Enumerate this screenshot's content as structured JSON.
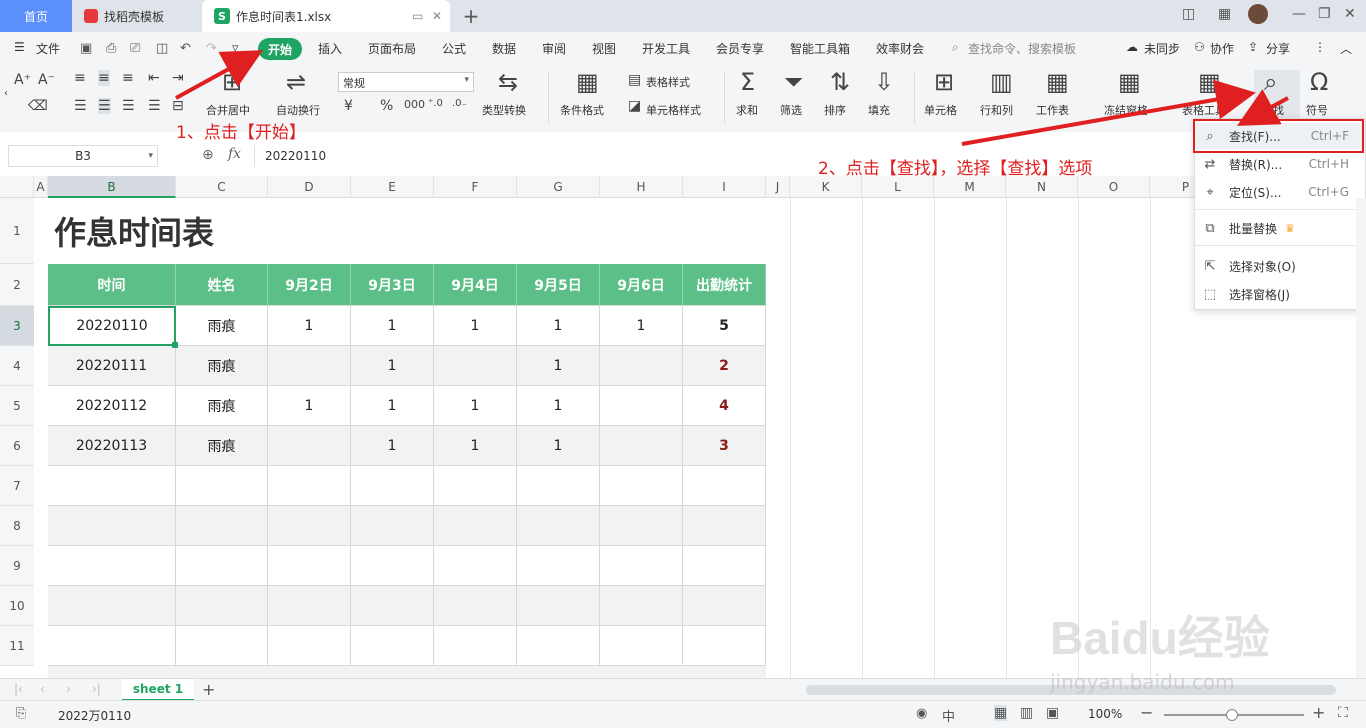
{
  "titlebar": {
    "home_tab": "首页",
    "docer_tab": "找稻壳模板",
    "file_tab": "作息时间表1.xlsx",
    "add_tab": "+"
  },
  "menubar": {
    "file_label": "文件",
    "active_tab": "开始",
    "tabs": [
      "插入",
      "页面布局",
      "公式",
      "数据",
      "审阅",
      "视图",
      "开发工具",
      "会员专享",
      "智能工具箱",
      "效率财会"
    ],
    "search_placeholder": "查找命令、搜索模板",
    "sync": "未同步",
    "collab": "协作",
    "share": "分享"
  },
  "ribbon": {
    "merge": "合并居中",
    "wrap": "自动换行",
    "number_format": "常规",
    "type_convert": "类型转换",
    "cond_format": "条件格式",
    "table_style": "表格样式",
    "cell_style": "单元格样式",
    "sum": "求和",
    "filter": "筛选",
    "sort": "排序",
    "fill": "填充",
    "cell": "单元格",
    "rowcol": "行和列",
    "sheet": "工作表",
    "freeze": "冻结窗格",
    "table_tools": "表格工具",
    "find": "查找",
    "symbol": "符号"
  },
  "formula": {
    "namebox": "B3",
    "fx": "fx",
    "value": "20220110"
  },
  "columns": [
    "A",
    "B",
    "C",
    "D",
    "E",
    "F",
    "G",
    "H",
    "I",
    "J",
    "K",
    "L",
    "M",
    "N",
    "O",
    "P"
  ],
  "rows": [
    "1",
    "2",
    "3",
    "4",
    "5",
    "6",
    "7",
    "8",
    "9",
    "10",
    "11"
  ],
  "sheet": {
    "title": "作息时间表",
    "headers": [
      "时间",
      "姓名",
      "9月2日",
      "9月3日",
      "9月4日",
      "9月5日",
      "9月6日",
      "出勤统计"
    ],
    "data": [
      [
        "20220110",
        "雨痕",
        "1",
        "1",
        "1",
        "1",
        "1",
        "5"
      ],
      [
        "20220111",
        "雨痕",
        "",
        "1",
        "",
        "1",
        "",
        "2"
      ],
      [
        "20220112",
        "雨痕",
        "1",
        "1",
        "1",
        "1",
        "",
        "4"
      ],
      [
        "20220113",
        "雨痕",
        "",
        "1",
        "1",
        "1",
        "",
        "3"
      ]
    ]
  },
  "dropdown": {
    "items": [
      {
        "label": "查找(F)...",
        "shortcut": "Ctrl+F",
        "icon": "search-icon"
      },
      {
        "label": "替换(R)...",
        "shortcut": "Ctrl+H",
        "icon": "replace-icon"
      },
      {
        "label": "定位(S)...",
        "shortcut": "Ctrl+G",
        "icon": "locate-icon"
      },
      {
        "label": "批量替换",
        "shortcut": "",
        "icon": "batch-replace-icon"
      },
      {
        "label": "选择对象(O)",
        "shortcut": "",
        "icon": "cursor-icon"
      },
      {
        "label": "选择窗格(J)",
        "shortcut": "",
        "icon": "select-pane-icon"
      }
    ]
  },
  "annotations": {
    "step1": "1、点击【开始】",
    "step2": "2、点击【查找】，选择【查找】选项"
  },
  "sheettabs": {
    "active": "sheet 1",
    "add": "+"
  },
  "status": {
    "cell_value": "2022万0110",
    "zoom": "100%"
  },
  "watermark": {
    "brand": "Baidu经验",
    "url": "jingyan.baidu.com"
  },
  "colors": {
    "accent": "#1fa463",
    "header_fill": "#5bbf87",
    "annotation": "#e02020"
  }
}
